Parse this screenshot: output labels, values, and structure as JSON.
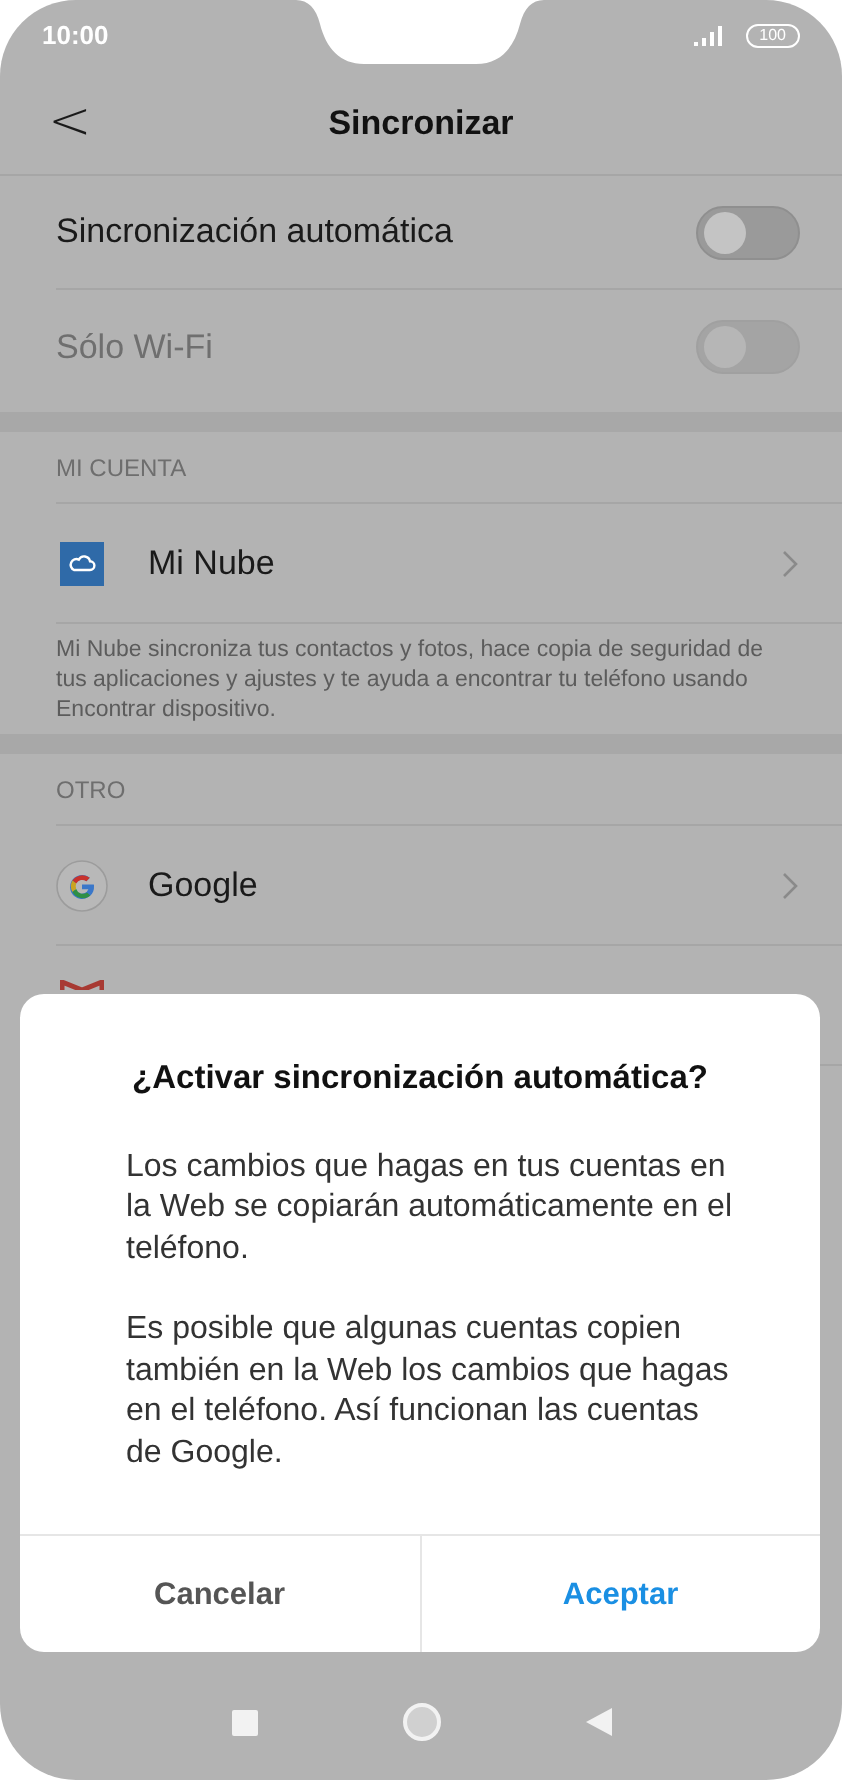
{
  "status_bar": {
    "time": "10:00",
    "battery": "100"
  },
  "header": {
    "back": "<",
    "title": "Sincronizar"
  },
  "toggles": [
    {
      "label": "Sincronización automática",
      "on": false,
      "disabled": false
    },
    {
      "label": "Sólo Wi-Fi",
      "on": false,
      "disabled": true
    }
  ],
  "sections": [
    {
      "title": "MI CUENTA",
      "items": [
        {
          "label": "Mi Nube",
          "kind": "cloud"
        }
      ],
      "description": "Mi Nube sincroniza tus contactos y fotos, hace copia de seguridad de tus aplicaciones y ajustes y te ayuda a encontrar tu teléfono usando Encontrar dispositivo."
    },
    {
      "title": "OTRO",
      "items": [
        {
          "label": "Google",
          "kind": "google"
        },
        {
          "kind": "mail"
        }
      ]
    }
  ],
  "dialog": {
    "title": "¿Activar sincronización automática?",
    "paragraphs": [
      "Los cambios que hagas en tus cuentas en la Web se copiarán automáticamente en el teléfono.",
      "Es posible que algunas cuentas copien también en la Web los cambios que hagas en el teléfono. Así funcionan las cuentas de Google."
    ],
    "buttons": [
      {
        "label": "Cancelar",
        "primary": false
      },
      {
        "label": "Aceptar",
        "primary": true
      }
    ]
  }
}
